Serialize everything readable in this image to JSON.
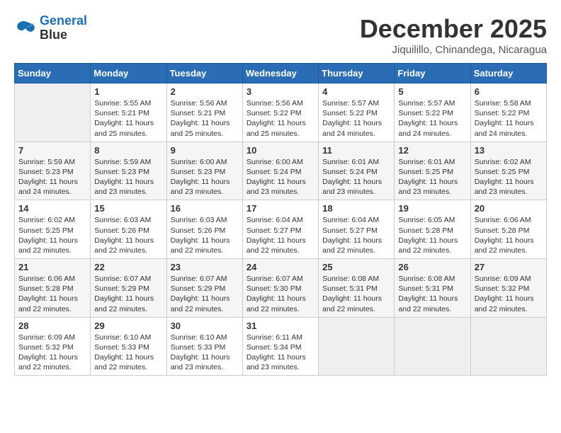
{
  "logo": {
    "line1": "General",
    "line2": "Blue"
  },
  "title": "December 2025",
  "location": "Jiquilillo, Chinandega, Nicaragua",
  "weekdays": [
    "Sunday",
    "Monday",
    "Tuesday",
    "Wednesday",
    "Thursday",
    "Friday",
    "Saturday"
  ],
  "weeks": [
    [
      {
        "day": "",
        "info": ""
      },
      {
        "day": "1",
        "info": "Sunrise: 5:55 AM\nSunset: 5:21 PM\nDaylight: 11 hours\nand 25 minutes."
      },
      {
        "day": "2",
        "info": "Sunrise: 5:56 AM\nSunset: 5:21 PM\nDaylight: 11 hours\nand 25 minutes."
      },
      {
        "day": "3",
        "info": "Sunrise: 5:56 AM\nSunset: 5:22 PM\nDaylight: 11 hours\nand 25 minutes."
      },
      {
        "day": "4",
        "info": "Sunrise: 5:57 AM\nSunset: 5:22 PM\nDaylight: 11 hours\nand 24 minutes."
      },
      {
        "day": "5",
        "info": "Sunrise: 5:57 AM\nSunset: 5:22 PM\nDaylight: 11 hours\nand 24 minutes."
      },
      {
        "day": "6",
        "info": "Sunrise: 5:58 AM\nSunset: 5:22 PM\nDaylight: 11 hours\nand 24 minutes."
      }
    ],
    [
      {
        "day": "7",
        "info": "Sunrise: 5:59 AM\nSunset: 5:23 PM\nDaylight: 11 hours\nand 24 minutes."
      },
      {
        "day": "8",
        "info": "Sunrise: 5:59 AM\nSunset: 5:23 PM\nDaylight: 11 hours\nand 23 minutes."
      },
      {
        "day": "9",
        "info": "Sunrise: 6:00 AM\nSunset: 5:23 PM\nDaylight: 11 hours\nand 23 minutes."
      },
      {
        "day": "10",
        "info": "Sunrise: 6:00 AM\nSunset: 5:24 PM\nDaylight: 11 hours\nand 23 minutes."
      },
      {
        "day": "11",
        "info": "Sunrise: 6:01 AM\nSunset: 5:24 PM\nDaylight: 11 hours\nand 23 minutes."
      },
      {
        "day": "12",
        "info": "Sunrise: 6:01 AM\nSunset: 5:25 PM\nDaylight: 11 hours\nand 23 minutes."
      },
      {
        "day": "13",
        "info": "Sunrise: 6:02 AM\nSunset: 5:25 PM\nDaylight: 11 hours\nand 23 minutes."
      }
    ],
    [
      {
        "day": "14",
        "info": "Sunrise: 6:02 AM\nSunset: 5:25 PM\nDaylight: 11 hours\nand 22 minutes."
      },
      {
        "day": "15",
        "info": "Sunrise: 6:03 AM\nSunset: 5:26 PM\nDaylight: 11 hours\nand 22 minutes."
      },
      {
        "day": "16",
        "info": "Sunrise: 6:03 AM\nSunset: 5:26 PM\nDaylight: 11 hours\nand 22 minutes."
      },
      {
        "day": "17",
        "info": "Sunrise: 6:04 AM\nSunset: 5:27 PM\nDaylight: 11 hours\nand 22 minutes."
      },
      {
        "day": "18",
        "info": "Sunrise: 6:04 AM\nSunset: 5:27 PM\nDaylight: 11 hours\nand 22 minutes."
      },
      {
        "day": "19",
        "info": "Sunrise: 6:05 AM\nSunset: 5:28 PM\nDaylight: 11 hours\nand 22 minutes."
      },
      {
        "day": "20",
        "info": "Sunrise: 6:06 AM\nSunset: 5:28 PM\nDaylight: 11 hours\nand 22 minutes."
      }
    ],
    [
      {
        "day": "21",
        "info": "Sunrise: 6:06 AM\nSunset: 5:28 PM\nDaylight: 11 hours\nand 22 minutes."
      },
      {
        "day": "22",
        "info": "Sunrise: 6:07 AM\nSunset: 5:29 PM\nDaylight: 11 hours\nand 22 minutes."
      },
      {
        "day": "23",
        "info": "Sunrise: 6:07 AM\nSunset: 5:29 PM\nDaylight: 11 hours\nand 22 minutes."
      },
      {
        "day": "24",
        "info": "Sunrise: 6:07 AM\nSunset: 5:30 PM\nDaylight: 11 hours\nand 22 minutes."
      },
      {
        "day": "25",
        "info": "Sunrise: 6:08 AM\nSunset: 5:31 PM\nDaylight: 11 hours\nand 22 minutes."
      },
      {
        "day": "26",
        "info": "Sunrise: 6:08 AM\nSunset: 5:31 PM\nDaylight: 11 hours\nand 22 minutes."
      },
      {
        "day": "27",
        "info": "Sunrise: 6:09 AM\nSunset: 5:32 PM\nDaylight: 11 hours\nand 22 minutes."
      }
    ],
    [
      {
        "day": "28",
        "info": "Sunrise: 6:09 AM\nSunset: 5:32 PM\nDaylight: 11 hours\nand 22 minutes."
      },
      {
        "day": "29",
        "info": "Sunrise: 6:10 AM\nSunset: 5:33 PM\nDaylight: 11 hours\nand 22 minutes."
      },
      {
        "day": "30",
        "info": "Sunrise: 6:10 AM\nSunset: 5:33 PM\nDaylight: 11 hours\nand 23 minutes."
      },
      {
        "day": "31",
        "info": "Sunrise: 6:11 AM\nSunset: 5:34 PM\nDaylight: 11 hours\nand 23 minutes."
      },
      {
        "day": "",
        "info": ""
      },
      {
        "day": "",
        "info": ""
      },
      {
        "day": "",
        "info": ""
      }
    ]
  ]
}
